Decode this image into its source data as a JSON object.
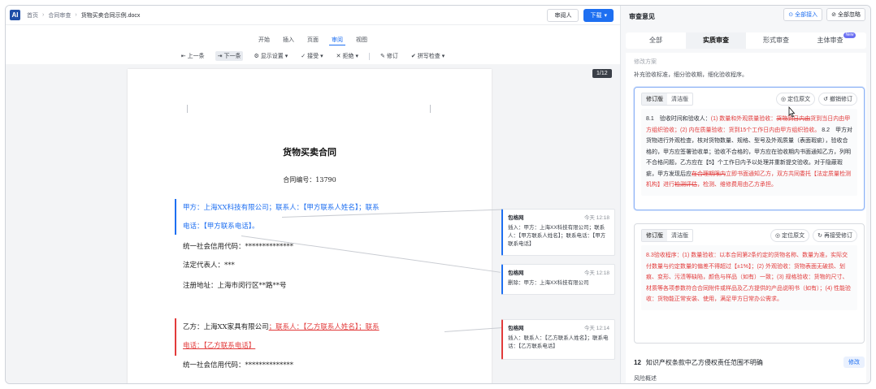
{
  "topbar": {
    "logo": "AI",
    "breadcrumb": [
      "首页",
      "合同审查",
      "货物买卖合同示例.docx"
    ],
    "buttons": {
      "reviewer": "审阅人",
      "download": "下载"
    }
  },
  "menu_tabs": [
    "开始",
    "插入",
    "页面",
    "审阅",
    "视图"
  ],
  "menu_active": "审阅",
  "toolbar": [
    "上一条",
    "下一条",
    "显示设置",
    "接受",
    "拒绝",
    "修订",
    "拼写检查"
  ],
  "document": {
    "title": "货物买卖合同",
    "contract_no": "合同编号：13790",
    "party_a": {
      "line1_prefix": "甲方：上海XX科技有限公司；联系人：【甲方联系人姓名】；联系",
      "line2": "电话：【甲方联系电话】。"
    },
    "credit_code_a": "统一社会信用代码：**************",
    "legal_rep": "法定代表人：***",
    "address": "注册地址：上海市闵行区**路**号",
    "party_b": {
      "prefix": "乙方：上海XX家具有限公司",
      "deleted1": "；联系人：【乙方联系人姓名】；联系",
      "deleted2": "电话：【乙方联系电话】"
    },
    "credit_code_b": "统一社会信用代码：**************",
    "page_indicator": "1/12"
  },
  "doc_comments": [
    {
      "author": "包格网",
      "time": "今天 12:18",
      "body": "插入：甲方：上海XX科技有限公司；联系人：【甲方联系人姓名】；联系电话：【甲方联系电话】"
    },
    {
      "author": "包格网",
      "time": "今天 12:18",
      "body": "删除：甲方：上海XX科技有限公司"
    },
    {
      "author": "包格网",
      "time": "今天 12:14",
      "body": "插入：联系人：【乙方联系人姓名】；联系电话：【乙方联系电话】"
    }
  ],
  "panel": {
    "title": "审查意见",
    "accept_all": "全部接入",
    "ignore_all": "全部忽略",
    "tabs": [
      "全部",
      "实质审查",
      "形式审查",
      "主体审查"
    ],
    "tab_badge": "New",
    "active_tab": "实质审查",
    "section_label": "修改方案",
    "hint": "补充验收标准，细分验收期，细化验收程序。",
    "suggestions": [
      {
        "mode_on": "修订版",
        "mode_off": "清洁版",
        "locate": "定位原文",
        "action": "撤销修订",
        "text_pre": "8.1　验收时间和验收人：",
        "text_red1": "(1) 数量和外观质量验收：",
        "text_strike1": "货物到日内由",
        "text_red2": "货到当日内由甲方组织验收；(2) 内在质量验收：货到15个工作日内由甲方组织验收。",
        "text_mid": "8.2　甲方对货物进行外观检查，核对货物数量、规格、型号及外观质量（表面瑕疵），验收合格的，甲方应签署验收单；验收不合格的，甲方应在验收期内书面通知乙方，列明不合格问题，乙方应在【5】个工作日内予以处理并重新提交验收。对于隐蔽瑕疵，甲方发现后应",
        "text_strike2": "在合理期限内",
        "text_red3": "立即书面通知乙方，双方共同委托【法定质量检测机构】进行",
        "text_strike3": "检测评估",
        "text_end": "，检测、维修费用由乙方承担。"
      },
      {
        "mode_on": "修订版",
        "mode_off": "清洁版",
        "locate": "定位原文",
        "action": "再接受修订",
        "text": "8.3验收程序：(1) 数量验收：以本合同第2条约定的货物名称、数量为准，实际交付数量与约定数量的偏差不得超过【±1%】；(2) 外观验收：货物表面无破损、划痕、变形、污渍等缺陷，颜色与样品（如有）一致；(3) 规格验收：货物的尺寸、材质等各项参数符合合同附件或样品及乙方提供的产品说明书（如有）；(4) 性能验收：货物能正常安装、使用，满足甲方日常办公需求。"
      }
    ],
    "issue": {
      "num": "12",
      "title": "知识产权条款中乙方侵权责任范围不明确",
      "edit": "修改"
    },
    "issue_sub": "风险概述"
  }
}
